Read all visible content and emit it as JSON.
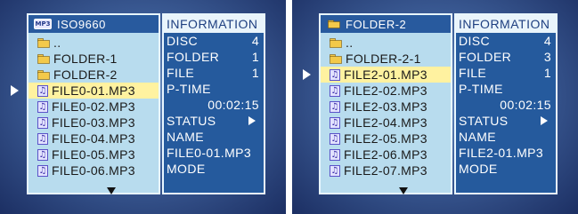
{
  "left": {
    "header_badge": "MP3",
    "header_text": "ISO9660",
    "info_title": "INFORMATION",
    "list": [
      {
        "label": "..",
        "type": "folder"
      },
      {
        "label": "FOLDER-1",
        "type": "folder"
      },
      {
        "label": "FOLDER-2",
        "type": "folder"
      },
      {
        "label": "FILE0-01.MP3",
        "type": "file",
        "selected": true
      },
      {
        "label": "FILE0-02.MP3",
        "type": "file"
      },
      {
        "label": "FILE0-03.MP3",
        "type": "file"
      },
      {
        "label": "FILE0-04.MP3",
        "type": "file"
      },
      {
        "label": "FILE0-05.MP3",
        "type": "file"
      },
      {
        "label": "FILE0-06.MP3",
        "type": "file"
      }
    ],
    "info": {
      "disc_label": "DISC",
      "disc_value": "4",
      "folder_label": "FOLDER",
      "folder_value": "1",
      "file_label": "FILE",
      "file_value": "1",
      "ptime_label": "P-TIME",
      "ptime_value": "00:02:15",
      "status_label": "STATUS",
      "name_label": "NAME",
      "name_value": "FILE0-01.MP3",
      "mode_label": "MODE"
    }
  },
  "right": {
    "header_text": "FOLDER-2",
    "info_title": "INFORMATION",
    "list": [
      {
        "label": "..",
        "type": "folder"
      },
      {
        "label": "FOLDER-2-1",
        "type": "folder"
      },
      {
        "label": "FILE2-01.MP3",
        "type": "file",
        "selected": true
      },
      {
        "label": "FILE2-02.MP3",
        "type": "file"
      },
      {
        "label": "FILE2-03.MP3",
        "type": "file"
      },
      {
        "label": "FILE2-04.MP3",
        "type": "file"
      },
      {
        "label": "FILE2-05.MP3",
        "type": "file"
      },
      {
        "label": "FILE2-06.MP3",
        "type": "file"
      },
      {
        "label": "FILE2-07.MP3",
        "type": "file"
      }
    ],
    "info": {
      "disc_label": "DISC",
      "disc_value": "4",
      "folder_label": "FOLDER",
      "folder_value": "3",
      "file_label": "FILE",
      "file_value": "1",
      "ptime_label": "P-TIME",
      "ptime_value": "00:02:15",
      "status_label": "STATUS",
      "name_label": "NAME",
      "name_value": "FILE2-01.MP3",
      "mode_label": "MODE"
    }
  },
  "colors": {
    "screen_bg": "#3d5e98",
    "list_bg": "#b8dcee",
    "selected_bg": "#fff2a0",
    "info_bg": "#255a9d",
    "folder_icon": "#f3c94a"
  },
  "icons": {
    "folder": "folder-icon",
    "file": "music-file-icon",
    "cursor": "play-arrow-icon",
    "scroll": "scroll-down-icon",
    "status": "play-status-icon",
    "disc_type": "mp3-disc-icon"
  }
}
